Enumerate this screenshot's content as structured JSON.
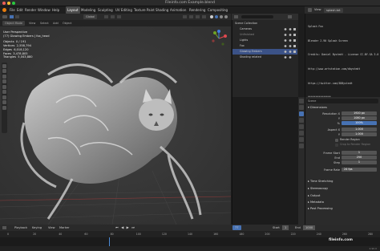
{
  "window": {
    "title": "Fileinfo.com Example.blend"
  },
  "menubar": {
    "menus": [
      "File",
      "Edit",
      "Render",
      "Window",
      "Help"
    ],
    "workspaces": [
      "Layout",
      "Modeling",
      "Sculpting",
      "UV Editing",
      "Texture Paint",
      "Shading",
      "Animation",
      "Rendering",
      "Compositing"
    ],
    "active_workspace": "Layout",
    "scene": "Scene",
    "view_layer": "View Layer"
  },
  "viewport_header": {
    "mode": "Object Mode",
    "menus": [
      "View",
      "Select",
      "Add",
      "Object"
    ],
    "orientation": "Global",
    "view_title": "User Perspective",
    "collection_path": "(77) Glowing Embers | fox_head"
  },
  "stats": [
    {
      "label": "Objects",
      "value": "0 / 191"
    },
    {
      "label": "Vertices",
      "value": "2,558,794"
    },
    {
      "label": "Edges",
      "value": "6,018,120"
    },
    {
      "label": "Faces",
      "value": "3,478,805"
    },
    {
      "label": "Triangles",
      "value": "5,043,880"
    }
  ],
  "outliner": {
    "header_label": "Scene Collection",
    "rows": [
      {
        "label": "Scene Collection",
        "selected": false
      },
      {
        "label": "Cameras",
        "selected": false
      },
      {
        "label": "Unfinished",
        "selected": false
      },
      {
        "label": "Lights",
        "selected": false
      },
      {
        "label": "Fox",
        "selected": false
      },
      {
        "label": "Glowing Embers",
        "selected": true
      },
      {
        "label": "Shading related",
        "selected": false
      }
    ]
  },
  "text_editor": {
    "file_name": "splash.txt",
    "menus": [
      "View",
      "Text",
      "Edit",
      "Select",
      "Format",
      "Templates"
    ],
    "lines": [
      "Splash Fox",
      "",
      "Blender 2.90 Splash Screen",
      "",
      "Credits: Daniel Bystedt - License CC-BY-SA 3.0",
      "",
      "http://www.artstation.com/dbystedt",
      "https://twitter.com/3DBystedt",
      "",
      "***************",
      "",
      "Shader textures from https://texturehaven.com/",
      "",
      "***************",
      "",
      "Switch between the different workspace tabs in",
      "the top to see more information about this",
      "Blender file."
    ]
  },
  "properties": {
    "scene_name": "Scene",
    "sections": {
      "dimensions": "Dimensions",
      "time_stretching": "Time Stretching",
      "stereoscopy": "Stereoscopy",
      "output": "Output",
      "metadata": "Metadata",
      "post_processing": "Post Processing"
    },
    "fields": [
      {
        "label": "Resolution X",
        "value": "1920 px",
        "blue": false
      },
      {
        "label": "Y",
        "value": "1080 px",
        "blue": false
      },
      {
        "label": "%",
        "value": "100%",
        "blue": true
      },
      {
        "label": "Aspect X",
        "value": "1.000",
        "blue": false
      },
      {
        "label": "Y",
        "value": "1.000",
        "blue": false
      }
    ],
    "render_region": "Render Region",
    "crop_to_region": "Crop to Render Region",
    "frames": [
      {
        "label": "Frame Start",
        "value": "1",
        "blue": false
      },
      {
        "label": "End",
        "value": "250",
        "blue": false
      },
      {
        "label": "Step",
        "value": "1",
        "blue": false
      }
    ],
    "frame_rate_label": "Frame Rate",
    "frame_rate_value": "24 fps"
  },
  "timeline": {
    "menus": [
      "Playback",
      "Keying",
      "View",
      "Marker"
    ],
    "current_frame": "77",
    "start_label": "Start",
    "start_value": "1",
    "end_label": "End",
    "end_value": "1000",
    "ruler_ticks": [
      "0",
      "20",
      "40",
      "60",
      "80",
      "100",
      "120",
      "140",
      "160",
      "180",
      "200",
      "220",
      "240",
      "260",
      "280"
    ],
    "current_frame_fraction": 0.275
  },
  "status_bar": {
    "version": "2.90.0"
  },
  "watermark": "fileinfo.com",
  "colors": {
    "accent": "#4772b3",
    "selected": "#3b5287",
    "playhead": "#4c8bd6"
  }
}
